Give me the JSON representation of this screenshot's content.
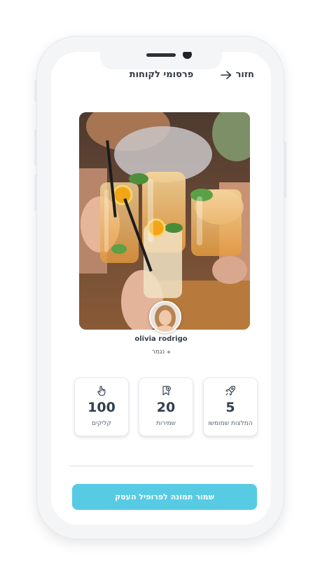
{
  "header": {
    "title": "פרסומי לקוחות",
    "back_label": "חזור"
  },
  "post": {
    "user_name": "olivia rodrigo",
    "status": "נגמר"
  },
  "stats": [
    {
      "icon": "rocket-icon",
      "value": "5",
      "label": "המלצות שמומשו"
    },
    {
      "icon": "bookmark-add-icon",
      "value": "20",
      "label": "שמירות"
    },
    {
      "icon": "tap-hand-icon",
      "value": "100",
      "label": "קליקים"
    }
  ],
  "action": {
    "save_label": "שמור תמונה לפרופיל העסק"
  },
  "colors": {
    "accent": "#57cbe4",
    "text_dark": "#33404d",
    "phone_frame": "#f4f5f7"
  }
}
